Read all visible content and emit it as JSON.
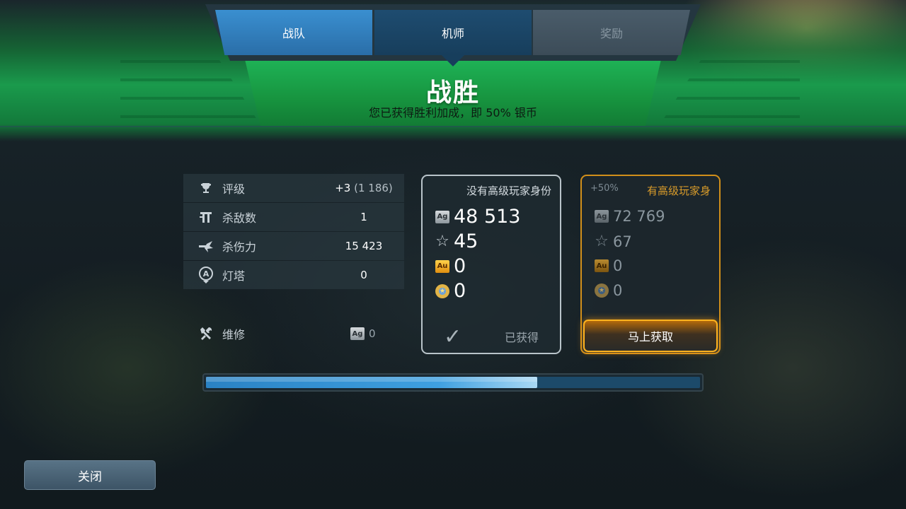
{
  "tabs": [
    {
      "label": "战队",
      "state": "default"
    },
    {
      "label": "机师",
      "state": "active"
    },
    {
      "label": "奖励",
      "state": "disabled"
    }
  ],
  "banner": {
    "title": "战胜",
    "subtitle": "您已获得胜利加成，即 50% 银币",
    "color": "#1a9a4c"
  },
  "stats": [
    {
      "icon": "trophy-icon",
      "label": "评级",
      "value": "+3",
      "extra": "(1 186)"
    },
    {
      "icon": "kills-icon",
      "label": "杀敌数",
      "value": "1",
      "extra": ""
    },
    {
      "icon": "damage-icon",
      "label": "杀伤力",
      "value": "15 423",
      "extra": ""
    },
    {
      "icon": "beacon-icon",
      "label": "灯塔",
      "value": "0",
      "extra": ""
    }
  ],
  "repair": {
    "label": "维修",
    "coin": "Ag",
    "value": "0"
  },
  "basic_rewards": {
    "title": "没有高级玩家身份",
    "silver": "48 513",
    "stars": "45",
    "gold": "0",
    "medals": "0",
    "status": "已获得"
  },
  "premium_rewards": {
    "bonus": "+50%",
    "title": "有高级玩家身",
    "silver": "72 769",
    "stars": "67",
    "gold": "0",
    "medals": "0",
    "button": "马上获取",
    "accent": "#d18f1a"
  },
  "coin_labels": {
    "silver": "Ag",
    "gold": "Au"
  },
  "progress": {
    "fraction": 0.67
  },
  "close_button": "关闭"
}
